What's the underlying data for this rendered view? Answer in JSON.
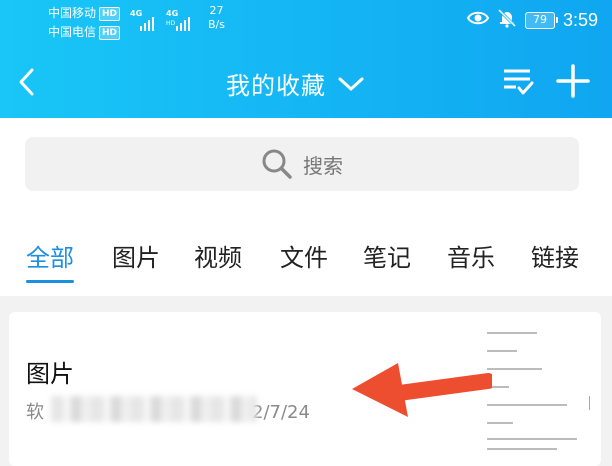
{
  "status_bar": {
    "carrier_1": "中国移动",
    "carrier_2": "中国电信",
    "hd_badge": "HD",
    "network_1": "4G",
    "network_2": "4G",
    "network_2_sub": "HD",
    "speed_value": "27",
    "speed_unit": "B/s",
    "battery": "79",
    "time": "3:59"
  },
  "nav": {
    "title": "我的收藏"
  },
  "search": {
    "placeholder": "搜索"
  },
  "tabs": [
    {
      "label": "全部",
      "active": true
    },
    {
      "label": "图片",
      "active": false
    },
    {
      "label": "视频",
      "active": false
    },
    {
      "label": "文件",
      "active": false
    },
    {
      "label": "笔记",
      "active": false
    },
    {
      "label": "音乐",
      "active": false
    },
    {
      "label": "链接",
      "active": false
    }
  ],
  "items": [
    {
      "title": "图片",
      "source_prefix": "软",
      "date_suffix": "2/7/24"
    }
  ],
  "colors": {
    "header_gradient_start": "#19c6f7",
    "header_gradient_end": "#10a6f1",
    "accent": "#1c8fe0",
    "annotation_arrow": "#ee4e30"
  }
}
